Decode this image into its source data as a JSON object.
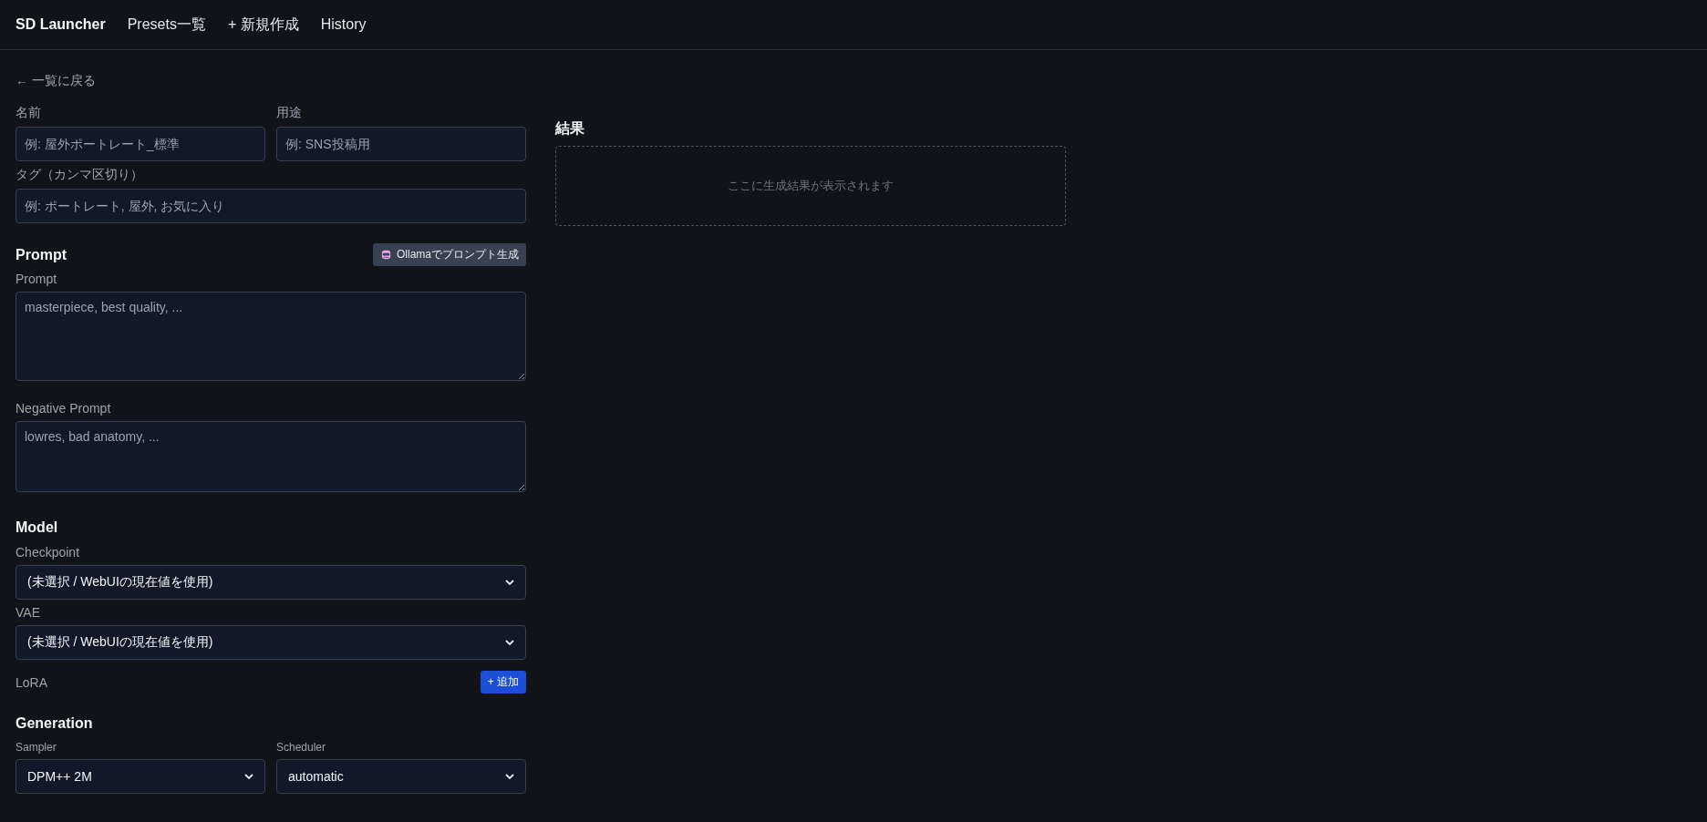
{
  "nav": {
    "brand": "SD Launcher",
    "links": [
      {
        "label": "Presets一覧",
        "selected": false
      },
      {
        "label": "+ 新規作成",
        "selected": false
      },
      {
        "label": "History",
        "selected": false
      }
    ]
  },
  "back_link": "← 一覧に戻る",
  "form": {
    "basic": {
      "name": {
        "label": "名前",
        "placeholder": "例: 屋外ポートレート_標準"
      },
      "purpose": {
        "label": "用途",
        "placeholder": "例: SNS投稿用"
      },
      "tags": {
        "label": "タグ（カンマ区切り）",
        "placeholder": "例: ポートレート, 屋外, お気に入り"
      }
    },
    "prompt_section": {
      "title": "Prompt",
      "ollama_button": "Ollamaでプロンプト生成",
      "prompt": {
        "label": "Prompt",
        "placeholder": "masterpiece, best quality, ..."
      },
      "negative": {
        "label": "Negative Prompt",
        "placeholder": "lowres, bad anatomy, ..."
      }
    },
    "model_section": {
      "title": "Model",
      "checkpoint": {
        "label": "Checkpoint",
        "value": "(未選択 / WebUIの現在値を使用)"
      },
      "vae": {
        "label": "VAE",
        "value": "(未選択 / WebUIの現在値を使用)"
      },
      "lora": {
        "label": "LoRA",
        "add_button": "+ 追加"
      }
    },
    "generation_section": {
      "title": "Generation",
      "sampler": {
        "label": "Sampler",
        "value": "DPM++ 2M"
      },
      "scheduler": {
        "label": "Scheduler",
        "value": "automatic"
      }
    }
  },
  "result": {
    "title": "結果",
    "empty_message": "ここに生成結果が表示されます"
  }
}
